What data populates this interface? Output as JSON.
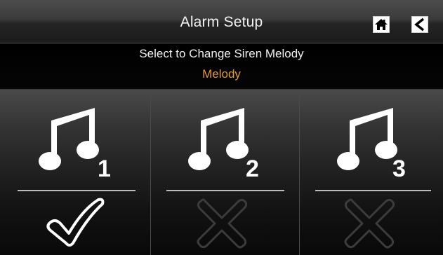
{
  "header": {
    "title": "Alarm Setup",
    "home_icon": "home-icon",
    "back_icon": "back-arrow-icon"
  },
  "subheader": {
    "instruction": "Select to Change Siren Melody",
    "section_label": "Melody",
    "section_label_color": "#e39b2f"
  },
  "melodies": [
    {
      "number": "1",
      "icon": "music-note-icon",
      "status": "selected",
      "status_icon": "checkmark-icon"
    },
    {
      "number": "2",
      "icon": "music-note-icon",
      "status": "not-selected",
      "status_icon": "x-icon"
    },
    {
      "number": "3",
      "icon": "music-note-icon",
      "status": "not-selected",
      "status_icon": "x-icon"
    }
  ]
}
